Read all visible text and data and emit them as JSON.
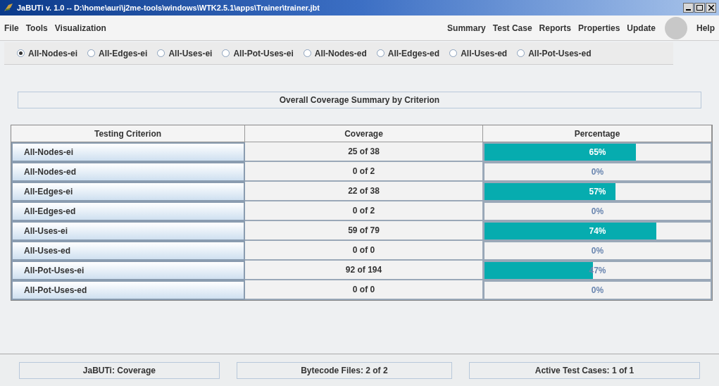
{
  "window": {
    "title": "JaBUTi v. 1.0 -- D:\\home\\auri\\j2me-tools\\windows\\WTK2.5.1\\apps\\Trainer\\trainer.jbt"
  },
  "menu_left": [
    "File",
    "Tools",
    "Visualization"
  ],
  "menu_right": [
    "Summary",
    "Test Case",
    "Reports",
    "Properties",
    "Update"
  ],
  "help": "Help",
  "criteria_radios": [
    {
      "label": "All-Nodes-ei",
      "selected": true
    },
    {
      "label": "All-Edges-ei",
      "selected": false
    },
    {
      "label": "All-Uses-ei",
      "selected": false
    },
    {
      "label": "All-Pot-Uses-ei",
      "selected": false
    },
    {
      "label": "All-Nodes-ed",
      "selected": false
    },
    {
      "label": "All-Edges-ed",
      "selected": false
    },
    {
      "label": "All-Uses-ed",
      "selected": false
    },
    {
      "label": "All-Pot-Uses-ed",
      "selected": false
    }
  ],
  "summary_title": "Overall Coverage Summary by Criterion",
  "table": {
    "columns": [
      "Testing Criterion",
      "Coverage",
      "Percentage"
    ],
    "rows": [
      {
        "criterion": "All-Nodes-ei",
        "coverage": "25 of 38",
        "percentage": "65%",
        "level": 0.67
      },
      {
        "criterion": "All-Nodes-ed",
        "coverage": "0 of 2",
        "percentage": "0%"
      },
      {
        "criterion": "All-Edges-ei",
        "coverage": "22 of 38",
        "percentage": "57%",
        "level": 0.58
      },
      {
        "criterion": "All-Edges-ed",
        "coverage": "0 of 2",
        "percentage": "0%"
      },
      {
        "criterion": "All-Uses-ei",
        "coverage": "59 of 79",
        "percentage": "74%",
        "level": 0.76
      },
      {
        "criterion": "All-Uses-ed",
        "coverage": "0 of 0",
        "percentage": "0%"
      },
      {
        "criterion": "All-Pot-Uses-ei",
        "coverage": "92 of 194",
        "percentage": "47%",
        "level": 0.48
      },
      {
        "criterion": "All-Pot-Uses-ed",
        "coverage": "0 of 0",
        "percentage": "0%"
      }
    ]
  },
  "status_bar": [
    "JaBUTi: Coverage",
    "Bytecode Files: 2 of 2",
    "Active Test Cases: 1 of 1"
  ]
}
